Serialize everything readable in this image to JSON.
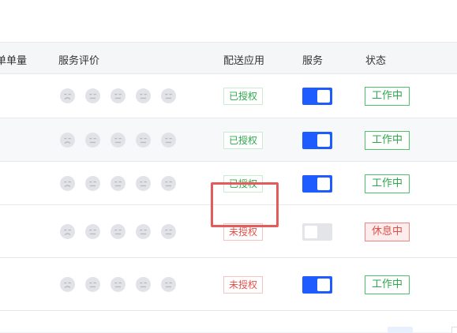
{
  "table": {
    "headers": {
      "order_count": "单单量",
      "rating": "服务评价",
      "delivery_app": "配送应用",
      "service": "服务",
      "status": "状态"
    },
    "rows": [
      {
        "rating_faces": 5,
        "delivery_app": "已授权",
        "delivery_authorized": true,
        "service_on": true,
        "status": "工作中",
        "status_type": "working"
      },
      {
        "rating_faces": 5,
        "delivery_app": "已授权",
        "delivery_authorized": true,
        "service_on": true,
        "status": "工作中",
        "status_type": "working"
      },
      {
        "rating_faces": 5,
        "delivery_app": "已授权",
        "delivery_authorized": true,
        "service_on": true,
        "status": "工作中",
        "status_type": "working"
      },
      {
        "rating_faces": 5,
        "delivery_app": "未授权",
        "delivery_authorized": false,
        "service_on": false,
        "status": "休息中",
        "status_type": "resting",
        "highlighted": true
      },
      {
        "rating_faces": 5,
        "delivery_app": "未授权",
        "delivery_authorized": false,
        "service_on": true,
        "status": "工作中",
        "status_type": "working"
      }
    ]
  },
  "colors": {
    "switch_on": "#1f5cff",
    "switch_off": "#e4e5e8",
    "authorized_text": "#2ca84b",
    "unauthorized_text": "#e0504a",
    "highlight_border": "#e45b5b"
  },
  "icons": {
    "rating_face": "neutral-face-icon",
    "rating_face_first": "sad-face-icon"
  }
}
